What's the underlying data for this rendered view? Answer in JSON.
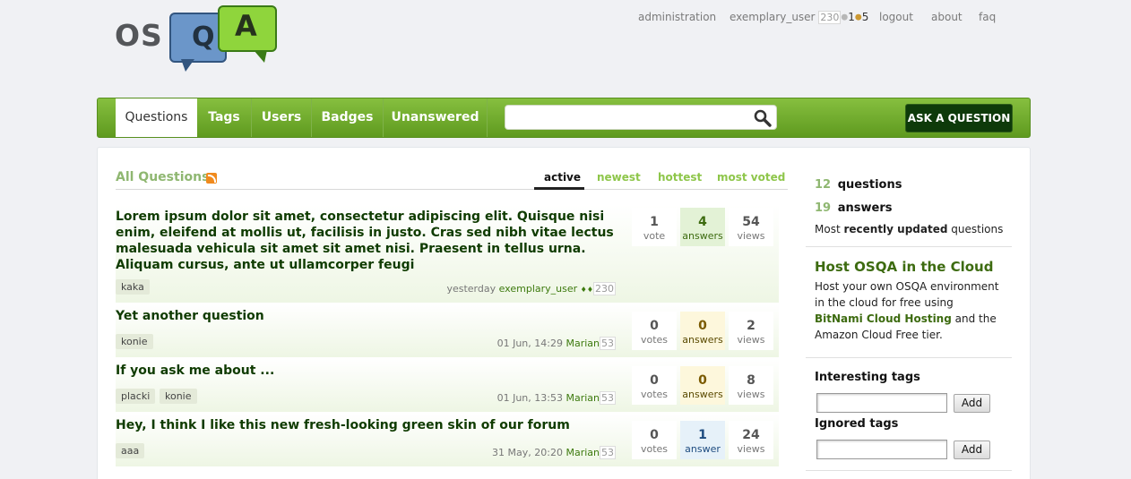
{
  "logo": {
    "text_os": "OS",
    "letter_q": "Q",
    "letter_a": "A"
  },
  "topnav": {
    "administration": "administration",
    "user": "exemplary_user",
    "reputation": "230",
    "silver_dot": "●",
    "silver_count": "1",
    "bronze_dot": "●",
    "bronze_count": "5",
    "logout": "logout",
    "about": "about",
    "faq": "faq"
  },
  "navbar": {
    "tabs": [
      "Questions",
      "Tags",
      "Users",
      "Badges",
      "Unanswered"
    ],
    "search_placeholder": "",
    "ask_button": "ASK A QUESTION"
  },
  "main": {
    "title": "All Questions",
    "sort_tabs": [
      "active",
      "newest",
      "hottest",
      "most voted"
    ],
    "questions": [
      {
        "title": "Lorem ipsum dolor sit amet, consectetur adipiscing elit. Quisque nisi enim, eleifend at mollis ut, facilisis in justo. Cras sed nibh vitae lectus malesuada vehicula sit amet sit amet nisi. Praesent in tellus urna. Aliquam cursus, ante ut ullamcorper feugi",
        "tags": [
          "kaka"
        ],
        "time": "yesterday",
        "user": "exemplary_user",
        "badges": "♦♦",
        "rep": "230",
        "votes": "1",
        "votes_label": "vote",
        "answers": "4",
        "answers_label": "answers",
        "views": "54",
        "views_label": "views"
      },
      {
        "title": "Yet another question",
        "tags": [
          "konie"
        ],
        "time": "01 Jun, 14:29",
        "user": "Marian",
        "rep": "53",
        "votes": "0",
        "votes_label": "votes",
        "answers": "0",
        "answers_label": "answers",
        "views": "2",
        "views_label": "views"
      },
      {
        "title": "If you ask me about ...",
        "tags": [
          "placki",
          "konie"
        ],
        "time": "01 Jun, 13:53",
        "user": "Marian",
        "rep": "53",
        "votes": "0",
        "votes_label": "votes",
        "answers": "0",
        "answers_label": "answers",
        "views": "8",
        "views_label": "views"
      },
      {
        "title": "Hey, I think I like this new fresh-looking green skin of our forum",
        "tags": [
          "aaa"
        ],
        "time": "31 May, 20:20",
        "user": "Marian",
        "rep": "53",
        "votes": "0",
        "votes_label": "votes",
        "answers": "1",
        "answers_label": "answer",
        "views": "24",
        "views_label": "views"
      }
    ]
  },
  "sidebar": {
    "questions_count": "12",
    "questions_label": "questions",
    "answers_count": "19",
    "answers_label": "answers",
    "updated_prefix": "Most ",
    "updated_bold": "recently updated",
    "updated_suffix": " questions",
    "host_title": "Host OSQA in the Cloud",
    "host_text_1": "Host your own OSQA environment in the cloud for free using ",
    "host_link": "BitNami Cloud Hosting",
    "host_text_2": " and the Amazon Cloud Free tier.",
    "interesting_tags": "Interesting tags",
    "ignored_tags": "Ignored tags",
    "add_label": "Add"
  }
}
